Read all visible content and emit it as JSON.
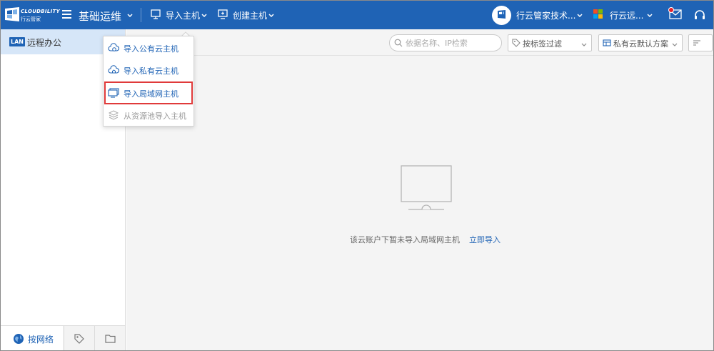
{
  "brand": {
    "name_en": "CLOUDBILITY",
    "name_cn": "行云管家"
  },
  "header": {
    "module_title": "基础运维",
    "nav": [
      {
        "label": "导入主机",
        "icon": "monitor-plus-icon"
      },
      {
        "label": "创建主机",
        "icon": "monitor-add-icon"
      }
    ],
    "account_label": "行云管家技术...",
    "cloud_label": "行云远..."
  },
  "sidebar": {
    "item": {
      "badge": "LAN",
      "label": "远程办公"
    },
    "tabs": [
      {
        "label": "按网络",
        "icon": "globe-icon",
        "active": true
      },
      {
        "label": "",
        "icon": "tag-icon",
        "active": false
      },
      {
        "label": "",
        "icon": "folder-icon",
        "active": false
      }
    ]
  },
  "toolbar": {
    "search_placeholder": "依据名称、IP检索",
    "tag_filter_label": "按标签过滤",
    "scheme_label": "私有云默认方案"
  },
  "import_menu": {
    "items": [
      {
        "label": "导入公有云主机",
        "icon": "cloud-import-icon",
        "disabled": false,
        "highlighted": false
      },
      {
        "label": "导入私有云主机",
        "icon": "cloud-home-icon",
        "disabled": false,
        "highlighted": false
      },
      {
        "label": "导入局域网主机",
        "icon": "lan-monitor-icon",
        "disabled": false,
        "highlighted": true
      },
      {
        "label": "从资源池导入主机",
        "icon": "layers-icon",
        "disabled": true,
        "highlighted": false
      }
    ]
  },
  "empty_state": {
    "message": "该云账户下暂未导入局域网主机",
    "link": "立即导入"
  },
  "colors": {
    "brand_blue": "#1f63b5",
    "selected_bg": "#d6e6f8",
    "highlight_red": "#e03a3a"
  }
}
